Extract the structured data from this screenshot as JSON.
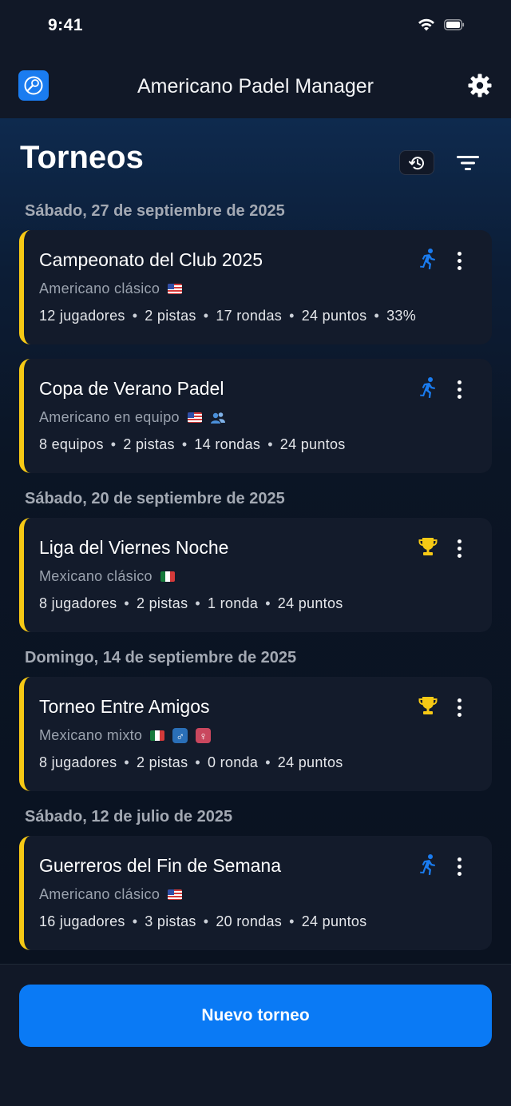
{
  "status_bar": {
    "time": "9:41"
  },
  "header": {
    "title": "Americano Padel Manager"
  },
  "page": {
    "title": "Torneos"
  },
  "colors": {
    "accent_blue": "#0a7af5",
    "card_stripe": "#f6c915",
    "trophy": "#f6c915",
    "runner": "#1a7cf0"
  },
  "groups": [
    {
      "date": "Sábado, 27 de septiembre de 2025"
    },
    {
      "date": "Sábado, 20 de septiembre de 2025"
    },
    {
      "date": "Domingo, 14 de septiembre de 2025"
    },
    {
      "date": "Sábado, 12 de julio de 2025"
    }
  ],
  "tournaments": [
    {
      "name": "Campeonato del Club 2025",
      "format": "Americano clásico",
      "status_icon": "runner-icon",
      "meta": [
        "12 jugadores",
        "2 pistas",
        "17 rondas",
        "24 puntos",
        "33%"
      ]
    },
    {
      "name": "Copa de Verano Padel",
      "format": "Americano en equipo",
      "status_icon": "runner-icon",
      "meta": [
        "8 equipos",
        "2 pistas",
        "14 rondas",
        "24 puntos"
      ]
    },
    {
      "name": "Liga del Viernes Noche",
      "format": "Mexicano clásico",
      "status_icon": "trophy-icon",
      "meta": [
        "8 jugadores",
        "2 pistas",
        "1 ronda",
        "24 puntos"
      ]
    },
    {
      "name": "Torneo Entre Amigos",
      "format": "Mexicano mixto",
      "status_icon": "trophy-icon",
      "meta": [
        "8 jugadores",
        "2 pistas",
        "0 ronda",
        "24 puntos"
      ]
    },
    {
      "name": "Guerreros del Fin de Semana",
      "format": "Americano clásico",
      "status_icon": "runner-icon",
      "meta": [
        "16 jugadores",
        "3 pistas",
        "20 rondas",
        "24 puntos"
      ]
    }
  ],
  "actions": {
    "new_tournament": "Nuevo torneo"
  }
}
